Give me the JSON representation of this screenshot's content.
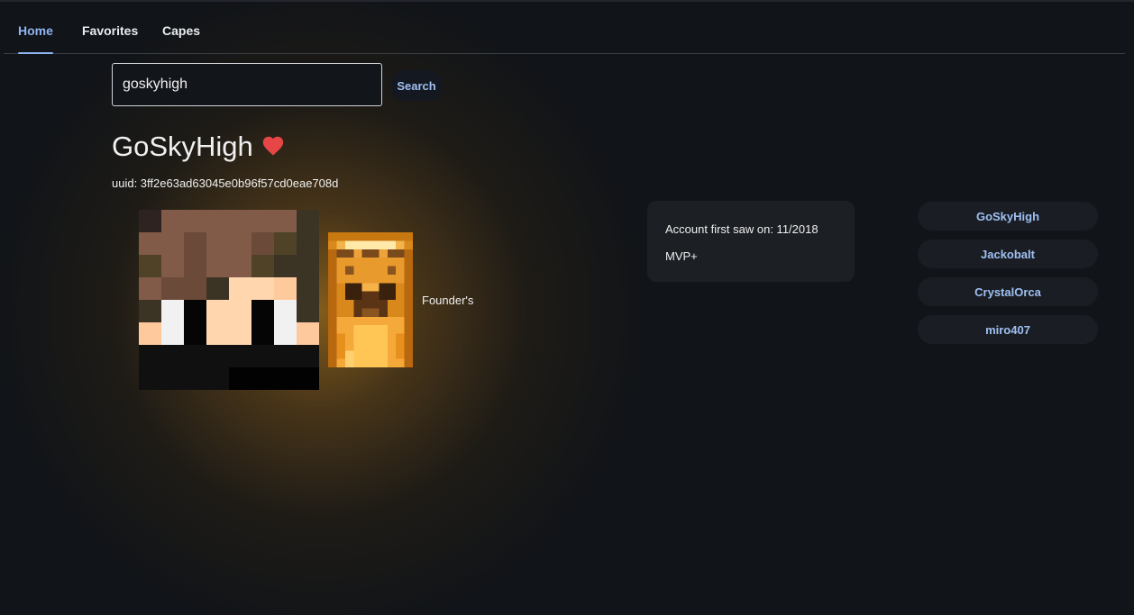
{
  "nav": {
    "tabs": [
      {
        "label": "Home",
        "active": true
      },
      {
        "label": "Favorites",
        "active": false
      },
      {
        "label": "Capes",
        "active": false
      }
    ]
  },
  "search": {
    "value": "goskyhigh",
    "button_label": "Search"
  },
  "player": {
    "name": "GoSkyHigh",
    "favorite_icon": "heart-icon",
    "favorite_color": "#e64646",
    "uuid_text": "uuid: 3ff2e63ad63045e0b96f57cd0eae708d",
    "cape_name": "Founder's"
  },
  "account": {
    "first_seen": "Account first saw on: 11/2018",
    "rank": "MVP+"
  },
  "name_history": [
    "GoSkyHigh",
    "Jackobalt",
    "CrystalOrca",
    "miro407"
  ],
  "colors": {
    "accent": "#90b4f0",
    "background": "#111418",
    "card": "#1c1f24"
  }
}
